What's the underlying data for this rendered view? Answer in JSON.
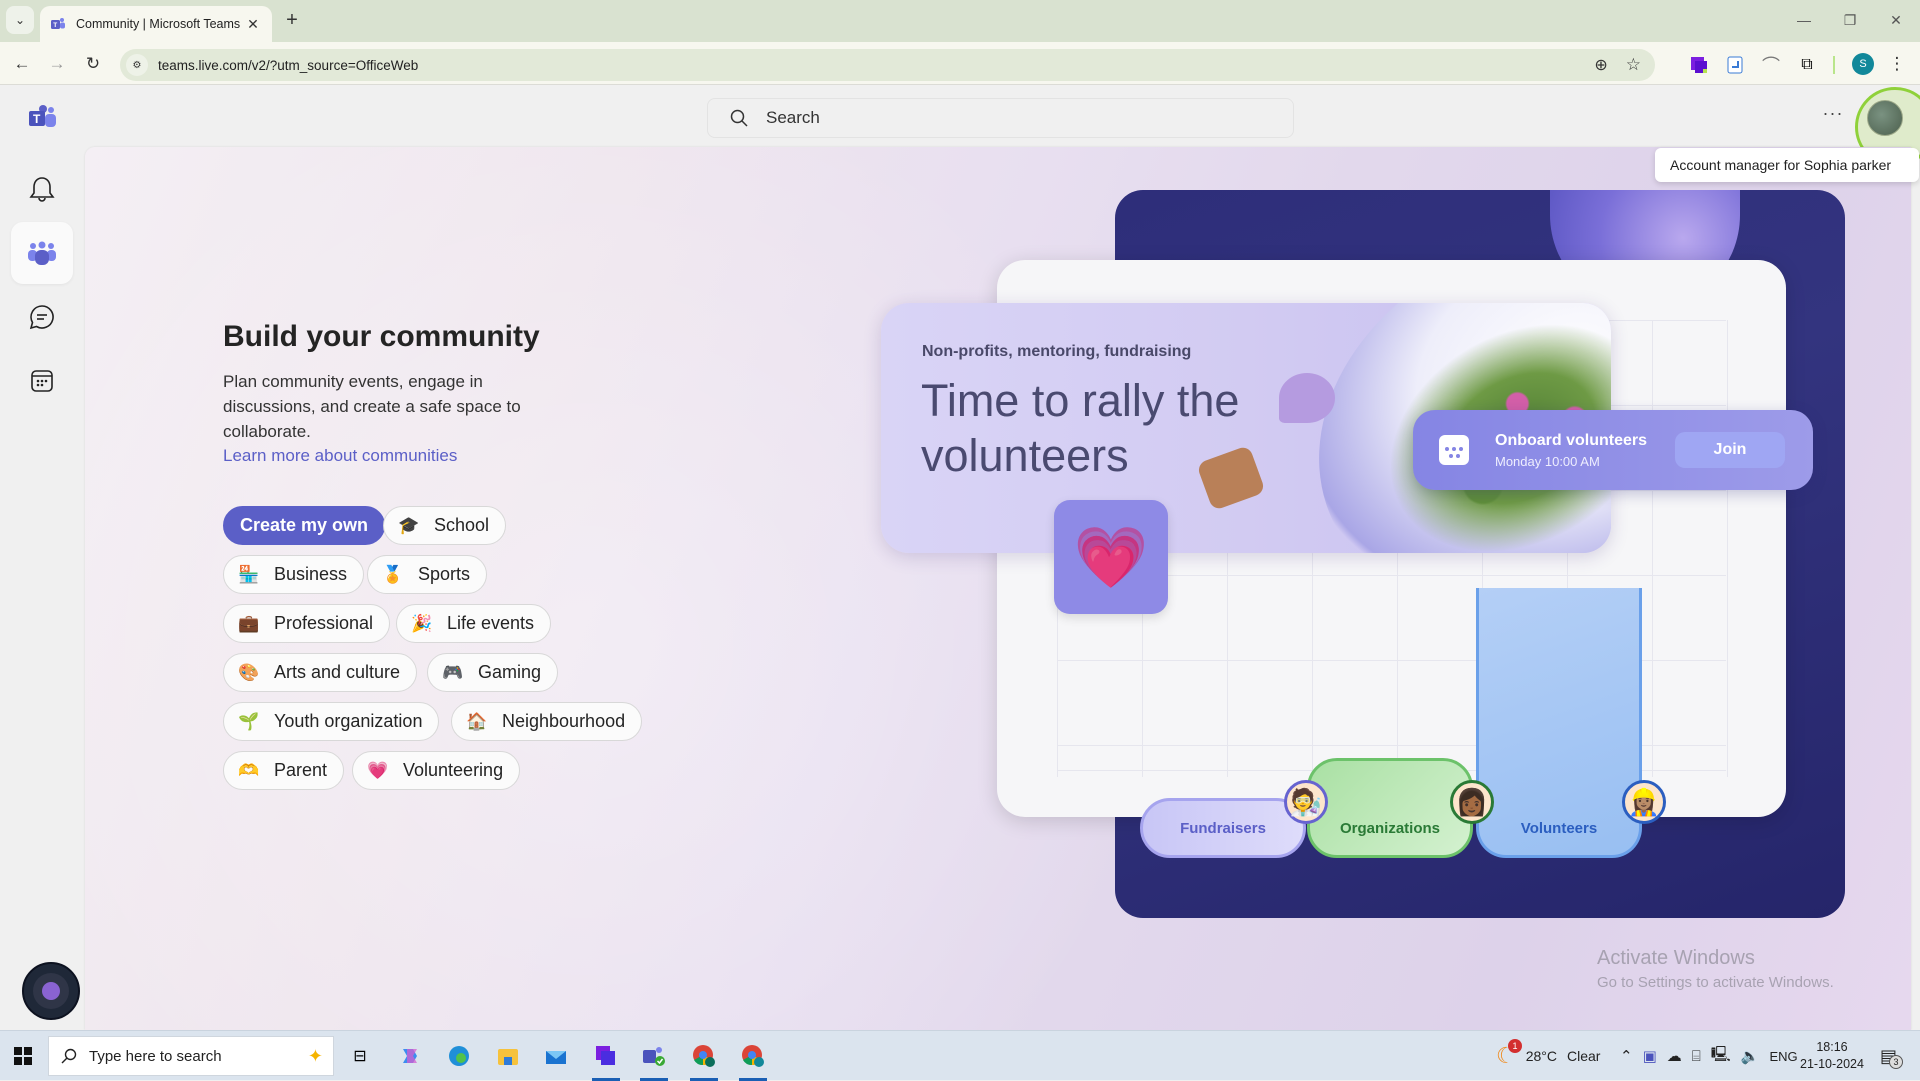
{
  "browser": {
    "tab_title": "Community | Microsoft Teams",
    "url": "teams.live.com/v2/?utm_source=OfficeWeb",
    "profile_initial": "S",
    "icons": {
      "tab_menu": "⌄",
      "tab_close": "✕",
      "new_tab": "+",
      "minimize": "—",
      "restore": "❐",
      "close": "✕",
      "back": "←",
      "forward": "→",
      "reload": "↻",
      "site_info": "⚙",
      "zoom": "⊕",
      "bookmark": "☆",
      "menu": "⋮"
    }
  },
  "teams": {
    "search_placeholder": "Search",
    "more_label": "···",
    "tooltip": "Account manager for Sophia parker",
    "rail": [
      {
        "name": "activity",
        "icon": "bell-icon"
      },
      {
        "name": "communities",
        "icon": "communities-icon",
        "active": true
      },
      {
        "name": "chat",
        "icon": "chat-icon"
      },
      {
        "name": "calendar",
        "icon": "calendar-icon"
      }
    ]
  },
  "main": {
    "heading": "Build your community",
    "description": "Plan community events, engage in discussions, and create a safe space to collaborate.",
    "learn_more": "Learn more about communities",
    "create_button": "Create my own",
    "chips": [
      {
        "label": "School",
        "emoji": "🎓"
      },
      {
        "label": "Business",
        "emoji": "🏪"
      },
      {
        "label": "Sports",
        "emoji": "🏅"
      },
      {
        "label": "Professional",
        "emoji": "💼"
      },
      {
        "label": "Life events",
        "emoji": "🎉"
      },
      {
        "label": "Arts and culture",
        "emoji": "🎨"
      },
      {
        "label": "Gaming",
        "emoji": "🎮"
      },
      {
        "label": "Youth organization",
        "emoji": "🌱"
      },
      {
        "label": "Neighbourhood",
        "emoji": "🏠"
      },
      {
        "label": "Parent",
        "emoji": "🫶"
      },
      {
        "label": "Volunteering",
        "emoji": "💗"
      }
    ]
  },
  "illustration": {
    "tag": "Non-profits, mentoring, fundraising",
    "title": "Time to rally the volunteers",
    "heart_emoji": "💗",
    "event": {
      "title": "Onboard volunteers",
      "time": "Monday 10:00 AM",
      "join_label": "Join"
    },
    "groups": [
      {
        "label": "Fundraisers",
        "person": "🧑‍🔬"
      },
      {
        "label": "Organizations",
        "person": "👩🏾"
      },
      {
        "label": "Volunteers",
        "person": "👷🏽‍♀️"
      }
    ]
  },
  "watermark": {
    "line1": "Activate Windows",
    "line2": "Go to Settings to activate Windows."
  },
  "taskbar": {
    "search_placeholder": "Type here to search",
    "weather_temp": "28°C",
    "weather_desc": "Clear",
    "weather_badge": "1",
    "language": "ENG",
    "time": "18:16",
    "date": "21-10-2024",
    "notification_count": "3",
    "apps": [
      "task-view",
      "copilot",
      "edge",
      "file-explorer",
      "mail",
      "power-automate",
      "teams",
      "chrome-a",
      "chrome-s"
    ]
  },
  "colors": {
    "accent": "#5b5fc7",
    "tabstrip": "#d9e2d0",
    "profile": "#11889a"
  }
}
